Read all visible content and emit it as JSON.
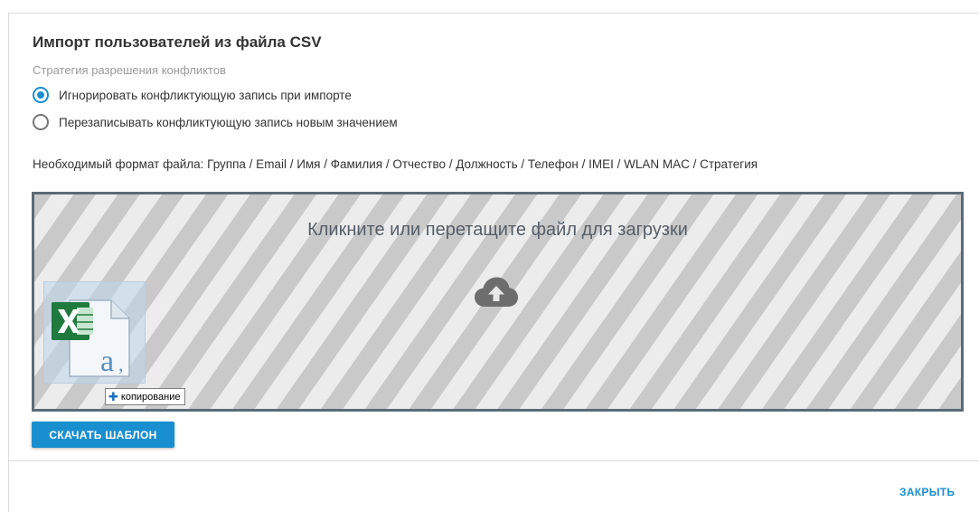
{
  "dialog": {
    "title": "Импорт пользователей из файла CSV",
    "subtitle": "Стратегия разрешения конфликтов",
    "radios": [
      {
        "label": "Игнорировать конфликтующую запись при импорте",
        "checked": true
      },
      {
        "label": "Перезаписывать конфликтующую запись новым значением",
        "checked": false
      }
    ],
    "format_text": "Необходимый формат файла: Группа / Email / Имя / Фамилия / Отчество / Должность / Телефон / IMEI / WLAN MAC / Стратегия",
    "dropzone": {
      "text": "Кликните или перетащите файл для загрузки",
      "icon": "cloud-upload-icon"
    },
    "drag_ghost": {
      "icon": "excel-file-icon",
      "copy_label": "копирование"
    },
    "download_button": "СКАЧАТЬ ШАБЛОН",
    "close_button": "ЗАКРЫТЬ"
  },
  "colors": {
    "accent": "#1a8fd0",
    "dropzone_border": "#5a6b78",
    "stripe_dark": "#c9c9c9",
    "stripe_light": "#ececec"
  }
}
